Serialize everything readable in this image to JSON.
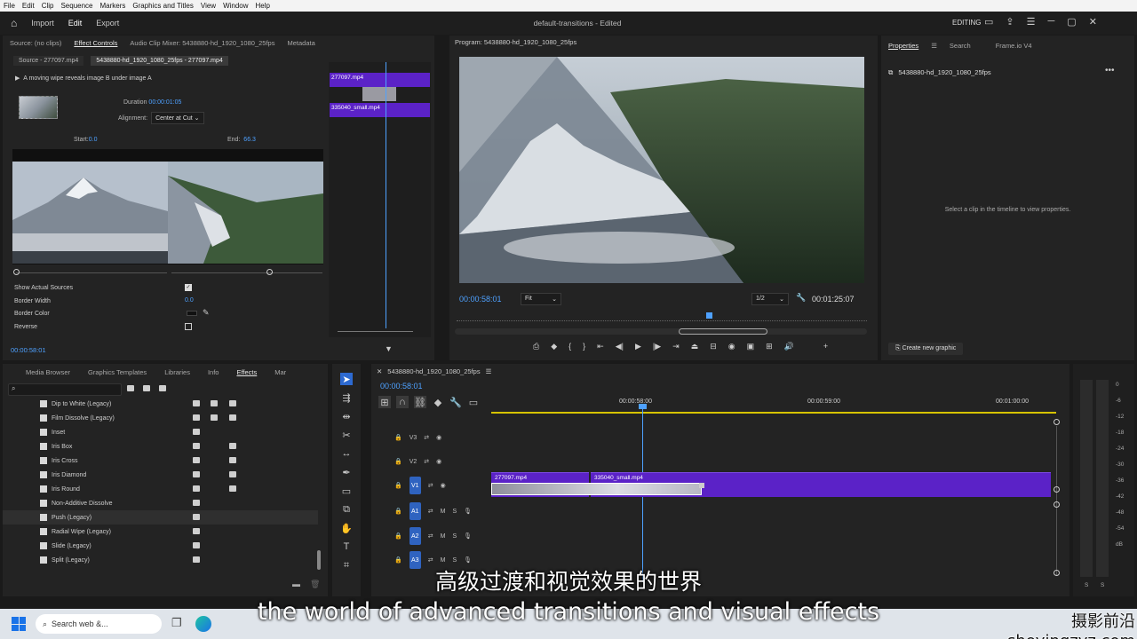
{
  "menu": [
    "File",
    "Edit",
    "Clip",
    "Sequence",
    "Markers",
    "Graphics and Titles",
    "View",
    "Window",
    "Help"
  ],
  "appbar": {
    "nav": [
      "Import",
      "Edit",
      "Export"
    ],
    "active_nav": "Edit",
    "doc_title": "default-transitions - Edited",
    "workspace": "EDITING"
  },
  "source_panel": {
    "tabs": [
      "Source: (no clips)",
      "Effect Controls",
      "Audio Clip Mixer: 5438880-hd_1920_1080_25fps",
      "Metadata"
    ],
    "active_tab": "Effect Controls",
    "subtabs": [
      "Source - 277097.mp4",
      "5438880-hd_1920_1080_25fps - 277097.mp4"
    ],
    "description": "A moving wipe reveals image B under image A",
    "duration_label": "Duration",
    "duration_value": "00:00:01:05",
    "alignment_label": "Alignment:",
    "alignment_value": "Center at Cut",
    "start_label": "Start:",
    "start_value": "0.0",
    "end_label": "End:",
    "end_value": "66.3",
    "props": [
      {
        "label": "Show Actual Sources",
        "value": ""
      },
      {
        "label": "Border Width",
        "value": "0.0"
      },
      {
        "label": "Border Color",
        "value": ""
      },
      {
        "label": "Reverse",
        "value": ""
      }
    ],
    "timecode": "00:00:58:01",
    "mini_clips": [
      "277097.mp4",
      "335040_small.mp4"
    ]
  },
  "program": {
    "title": "Program: 5438880-hd_1920_1080_25fps",
    "timecode": "00:00:58:01",
    "fit": "Fit",
    "resolution": "1/2",
    "duration": "00:01:25:07"
  },
  "properties": {
    "tabs": [
      "Properties",
      "Search",
      "Frame.io V4"
    ],
    "clip_name": "5438880-hd_1920_1080_25fps",
    "hint": "Select a clip in the timeline to view properties.",
    "create_graphic": "Create new graphic"
  },
  "effects_panel": {
    "tabs": [
      "Media Browser",
      "Graphics Templates",
      "Libraries",
      "Info",
      "Effects",
      "Mar"
    ],
    "active_tab": "Effects",
    "items": [
      "Dip to White (Legacy)",
      "Film Dissolve (Legacy)",
      "Inset",
      "Iris Box",
      "Iris Cross",
      "Iris Diamond",
      "Iris Round",
      "Non-Additive Dissolve",
      "Push (Legacy)",
      "Radial Wipe (Legacy)",
      "Slide (Legacy)",
      "Split (Legacy)"
    ],
    "selected": "Push (Legacy)"
  },
  "timeline": {
    "sequence": "5438880-hd_1920_1080_25fps",
    "timecode": "00:00:58:01",
    "ruler": [
      "00:00:58:00",
      "00:00:59:00",
      "00:01:00:00"
    ],
    "video_tracks": [
      "V3",
      "V2",
      "V1"
    ],
    "audio_tracks": [
      "A1",
      "A2",
      "A3"
    ],
    "clips": [
      "277097.mp4",
      "335040_small.mp4"
    ],
    "clip_color": "#5b22c7"
  },
  "meter_ticks": [
    "0",
    "-6",
    "-12",
    "-18",
    "-24",
    "-30",
    "-36",
    "-42",
    "-48",
    "-54",
    "dB"
  ],
  "meter_footer": [
    "S",
    "S"
  ],
  "subtitles": {
    "zh": "高级过渡和视觉效果的世界",
    "en": "the world of advanced transitions and visual effects"
  },
  "watermark": "摄影前沿 sheyingzyz.com",
  "taskbar": {
    "search_placeholder": "Search web &..."
  }
}
